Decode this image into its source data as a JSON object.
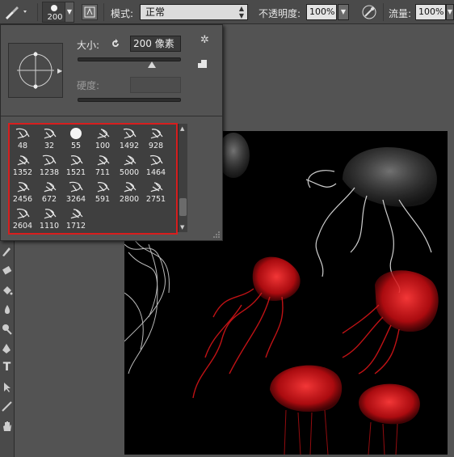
{
  "options_bar": {
    "brush_size": "200",
    "mode_label": "模式:",
    "mode_value": "正常",
    "opacity_label": "不透明度:",
    "opacity_value": "100%",
    "flow_label": "流量:",
    "flow_value": "100%"
  },
  "brush_picker": {
    "size_label": "大小:",
    "size_value": "200 像素",
    "hardness_label": "硬度:",
    "size_slider_fraction": 0.72,
    "presets": [
      {
        "size": "48"
      },
      {
        "size": "32"
      },
      {
        "size": "55"
      },
      {
        "size": "100"
      },
      {
        "size": "1492"
      },
      {
        "size": "928"
      },
      {
        "size": "1352"
      },
      {
        "size": "1238"
      },
      {
        "size": "1521"
      },
      {
        "size": "711"
      },
      {
        "size": "5000"
      },
      {
        "size": "1464"
      },
      {
        "size": "2456"
      },
      {
        "size": "672"
      },
      {
        "size": "3264"
      },
      {
        "size": "591"
      },
      {
        "size": "2800"
      },
      {
        "size": "2751"
      },
      {
        "size": "2604"
      },
      {
        "size": "1110"
      },
      {
        "size": "1712"
      }
    ],
    "highlight_color": "#d81e1e"
  },
  "colors": {
    "jellyfish_white": "#e8e8e8",
    "jellyfish_red": "#e0141a",
    "canvas_bg": "#000000"
  }
}
